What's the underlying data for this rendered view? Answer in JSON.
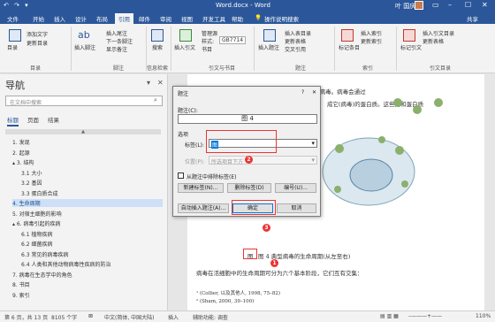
{
  "title_bar": {
    "quick_access": "↶ ↷ ▾",
    "document_title": "Word.docx - Word",
    "user": "叶 国庆",
    "min": "–",
    "max": "☐",
    "close": "✕",
    "ribbon_toggle": "▭"
  },
  "menu": {
    "tabs": [
      "文件",
      "开始",
      "插入",
      "设计",
      "布局",
      "引用",
      "邮件",
      "审阅",
      "视图",
      "开发工具",
      "帮助"
    ],
    "active_index": 5,
    "tellme": "操作说明搜索",
    "share": "共享"
  },
  "ribbon": {
    "toc": {
      "big": "目录",
      "add_text": "添加文字",
      "update": "更新目录",
      "group": "目录"
    },
    "footnotes": {
      "big_icon": "ab",
      "big": "插入脚注",
      "insert_endnote": "插入尾注",
      "next": "下一条脚注",
      "show": "显示备注",
      "group": "脚注"
    },
    "research": {
      "big": "搜索",
      "group": "信息检索"
    },
    "citations": {
      "big": "插入引文",
      "manage": "管理源",
      "style_label": "样式:",
      "style_value": "GB7714",
      "bibliography": "书目",
      "group": "引文与书目"
    },
    "captions": {
      "big": "插入题注",
      "insert_table": "插入表目录",
      "update_table": "更新表格",
      "cross_ref": "交叉引用",
      "group": "题注"
    },
    "index": {
      "big": "标记条目",
      "insert": "插入索引",
      "update": "更新索引",
      "group": "索引"
    },
    "toa": {
      "big": "标记引文",
      "insert": "插入引文目录",
      "update": "更新表格",
      "group": "引文目录"
    }
  },
  "nav": {
    "title": "导航",
    "search_placeholder": "在文档中搜索",
    "tabs": [
      "标题",
      "页面",
      "结果"
    ],
    "items": [
      {
        "label": "1. 发现"
      },
      {
        "label": "2. 起源"
      },
      {
        "label": "▴ 3. 结构"
      },
      {
        "label": "3.1 大小"
      },
      {
        "label": "3.2 基因"
      },
      {
        "label": "3.3 蛋白质合成"
      },
      {
        "label": "4. 生命周期"
      },
      {
        "label": "5. 对宿主细胞的影响"
      },
      {
        "label": "▴ 6. 病毒引起的疾病"
      },
      {
        "label": "6.1 植物疾病"
      },
      {
        "label": "6.2 细菌疾病"
      },
      {
        "label": "6.3 常见的病毒疾病"
      },
      {
        "label": "6.4 人类和其他动物病毒性疾病的防治"
      },
      {
        "label": "7. 病毒在生态学中的角色"
      },
      {
        "label": "8. 书目"
      },
      {
        "label": "9. 索引"
      }
    ],
    "selected_index": 6
  },
  "document": {
    "line1": "“制造”出数以千计的子代病毒。病毒会通过",
    "line2": "成它(病毒)的蛋白质。这些酶和蛋白质",
    "caption": "图 4 典型病毒的生命周期(从左至右)",
    "caption_box": "图",
    "para": "病毒在活细胞中的生命周期可分为六个基本阶段，它们互有交集：",
    "footnote1": "¹ (Collier, 以及其他人, 1998, 75–82)",
    "footnote2": "² (Sham, 2000, 39–100)"
  },
  "dialog": {
    "title": "题注",
    "help": "?",
    "close": "✕",
    "caption_label": "题注(C):",
    "caption_value": "图 4",
    "options_label": "选项",
    "label_label": "标签(L):",
    "label_value": "图",
    "position_label": "位置(P):",
    "position_value": "所选项目下方",
    "exclude_label": "从题注中排除标签(E)",
    "new_label_btn": "新建标签(N)...",
    "delete_label_btn": "删除标签(D)",
    "numbering_btn": "编号(U)...",
    "autocaption_btn": "自动插入题注(A)...",
    "ok_btn": "确定",
    "cancel_btn": "取消",
    "markers": [
      "1",
      "2",
      "3"
    ]
  },
  "status": {
    "page": "第 6 页，共 13 页",
    "words": "8105 个字",
    "lang": "中文(简体, 中国大陆)",
    "mode": "插入",
    "accessibility": "辅助功能: 调查",
    "zoom": "110%"
  }
}
